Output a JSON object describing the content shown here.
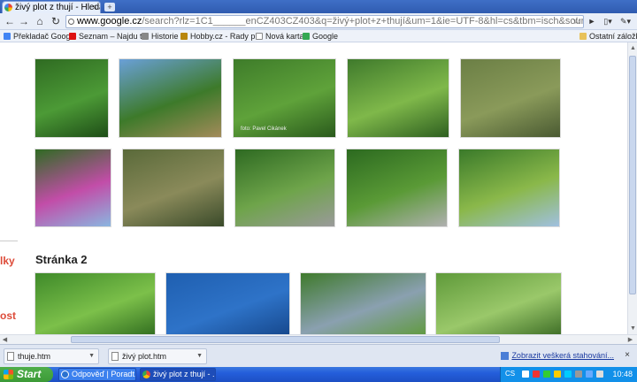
{
  "browser": {
    "tab_title": "živý plot z thují - Hleda...",
    "tab_close": "×",
    "new_tab": "+",
    "back": "←",
    "forward": "→",
    "reload": "↻",
    "home": "⌂",
    "url_domain": "www.google.cz",
    "url_rest": "/search?rlz=1C1______enCZ403CZ403&q=živý+plot+z+thují&um=1&ie=UTF-8&hl=cs&tbm=isch&source=og&sa=N&tab=wi",
    "star": "☆",
    "play": "►",
    "page_menu": "▯▾",
    "wrench": "✎▾"
  },
  "bookmarks": [
    {
      "label": "Překladač Google",
      "color": "#4285f4"
    },
    {
      "label": "Seznam – Najdu t...",
      "color": "#d11"
    },
    {
      "label": "Historie",
      "color": "#888"
    },
    {
      "label": "Hobby.cz - Rady p...",
      "color": "#b8860b"
    },
    {
      "label": "Nová karta",
      "color": "#fff"
    },
    {
      "label": "Google",
      "color": "#34a853"
    }
  ],
  "other_bookmarks": "Ostatní záložky",
  "page": {
    "side_text_1": "lky",
    "side_text_2": "ost",
    "section_title": "Stránka 2",
    "photo_caption": "foto: Pavel Cikánek",
    "row1": [
      {
        "name": "thuja-hedge-1",
        "colors": [
          "#2f6b22",
          "#4c9a36",
          "#1e4d17"
        ]
      },
      {
        "name": "thuja-hedge-2",
        "colors": [
          "#6aa0d8",
          "#3d7a2a",
          "#a38b5a"
        ]
      },
      {
        "name": "thuja-hedge-3",
        "colors": [
          "#3e7c2a",
          "#5fa23a",
          "#2a5a1c"
        ]
      },
      {
        "name": "thuja-hedge-4",
        "colors": [
          "#3f7a2c",
          "#7fb84a",
          "#2e5f20"
        ]
      },
      {
        "name": "thuja-hedge-5",
        "colors": [
          "#6b7f45",
          "#8a9a5a",
          "#4a5a32"
        ]
      }
    ],
    "row2": [
      {
        "name": "thuja-hedge-6",
        "colors": [
          "#2f6b22",
          "#c24da8",
          "#8ab6e0"
        ]
      },
      {
        "name": "thuja-hedge-7",
        "colors": [
          "#5a6a3a",
          "#8a8a5a",
          "#3a4a2a"
        ]
      },
      {
        "name": "thuja-hedge-8",
        "colors": [
          "#2e6a22",
          "#6ea44a",
          "#9a9a9a"
        ]
      },
      {
        "name": "thuja-hedge-9",
        "colors": [
          "#2c6a20",
          "#5a9a36",
          "#b0b0b0"
        ]
      },
      {
        "name": "thuja-hedge-10",
        "colors": [
          "#3a7a2a",
          "#8ab84a",
          "#a0c0e0"
        ]
      }
    ],
    "row3": [
      {
        "name": "thuja-hedge-11",
        "colors": [
          "#3f8a2a",
          "#7cc04a",
          "#2e6a1e"
        ]
      },
      {
        "name": "thuja-hedge-12",
        "colors": [
          "#1f5fb0",
          "#2e73c8",
          "#15468a"
        ]
      },
      {
        "name": "thuja-hedge-13",
        "colors": [
          "#3f7a2c",
          "#8aa0b0",
          "#5f9a3a"
        ]
      },
      {
        "name": "thuja-hedge-14",
        "colors": [
          "#5f9a3a",
          "#9ac86a",
          "#3a6a24"
        ]
      }
    ]
  },
  "downloads": {
    "items": [
      "thuje.htm",
      "živý plot.htm"
    ],
    "show_all": "Zobrazit veškerá stahování...",
    "close": "×"
  },
  "taskbar": {
    "start": "Start",
    "tasks": [
      "Odpověď | Poradt...",
      "živý plot z thují - ..."
    ],
    "lang": "CS",
    "clock": "10:48"
  }
}
